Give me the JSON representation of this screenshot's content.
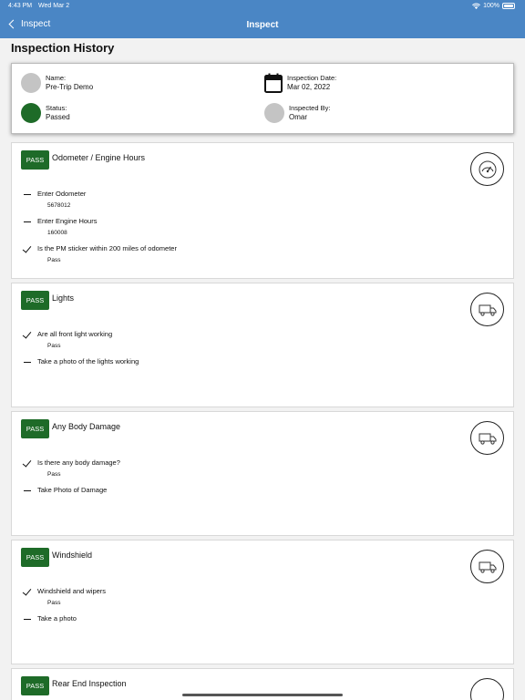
{
  "status_bar": {
    "time": "4:43 PM",
    "date": "Wed Mar 2",
    "battery": "100%"
  },
  "nav": {
    "back_label": "Inspect",
    "title": "Inspect"
  },
  "page_title": "Inspection History",
  "summary": {
    "name_label": "Name:",
    "name_value": "Pre-Trip Demo",
    "date_label": "Inspection Date:",
    "date_value": "Mar 02, 2022",
    "status_label": "Status:",
    "status_value": "Passed",
    "inspected_label": "Inspected By:",
    "inspected_value": "Omar"
  },
  "sections": [
    {
      "badge": "PASS",
      "title": "Odometer / Engine Hours",
      "icon": "speedometer-icon",
      "items": [
        {
          "mark": "dash",
          "label": "Enter Odometer",
          "value": "5678012"
        },
        {
          "mark": "dash",
          "label": "Enter Engine Hours",
          "value": "160008"
        },
        {
          "mark": "check",
          "label": "Is the PM sticker within 200 miles of odometer",
          "value": "Pass"
        }
      ]
    },
    {
      "badge": "PASS",
      "title": "Lights",
      "icon": "truck-icon",
      "items": [
        {
          "mark": "check",
          "label": "Are all front light working",
          "value": "Pass"
        },
        {
          "mark": "dash",
          "label": "Take a photo of the lights working",
          "value": ""
        }
      ]
    },
    {
      "badge": "PASS",
      "title": "Any Body Damage",
      "icon": "truck-icon",
      "items": [
        {
          "mark": "check",
          "label": "Is there any body damage?",
          "value": "Pass"
        },
        {
          "mark": "dash",
          "label": "Take Photo of Damage",
          "value": ""
        }
      ]
    },
    {
      "badge": "PASS",
      "title": "Windshield",
      "icon": "truck-icon",
      "items": [
        {
          "mark": "check",
          "label": "Windshield and wipers",
          "value": "Pass"
        },
        {
          "mark": "dash",
          "label": "Take a photo",
          "value": ""
        }
      ]
    },
    {
      "badge": "PASS",
      "title": "Rear End Inspection",
      "icon": "truck-icon",
      "items": []
    }
  ]
}
